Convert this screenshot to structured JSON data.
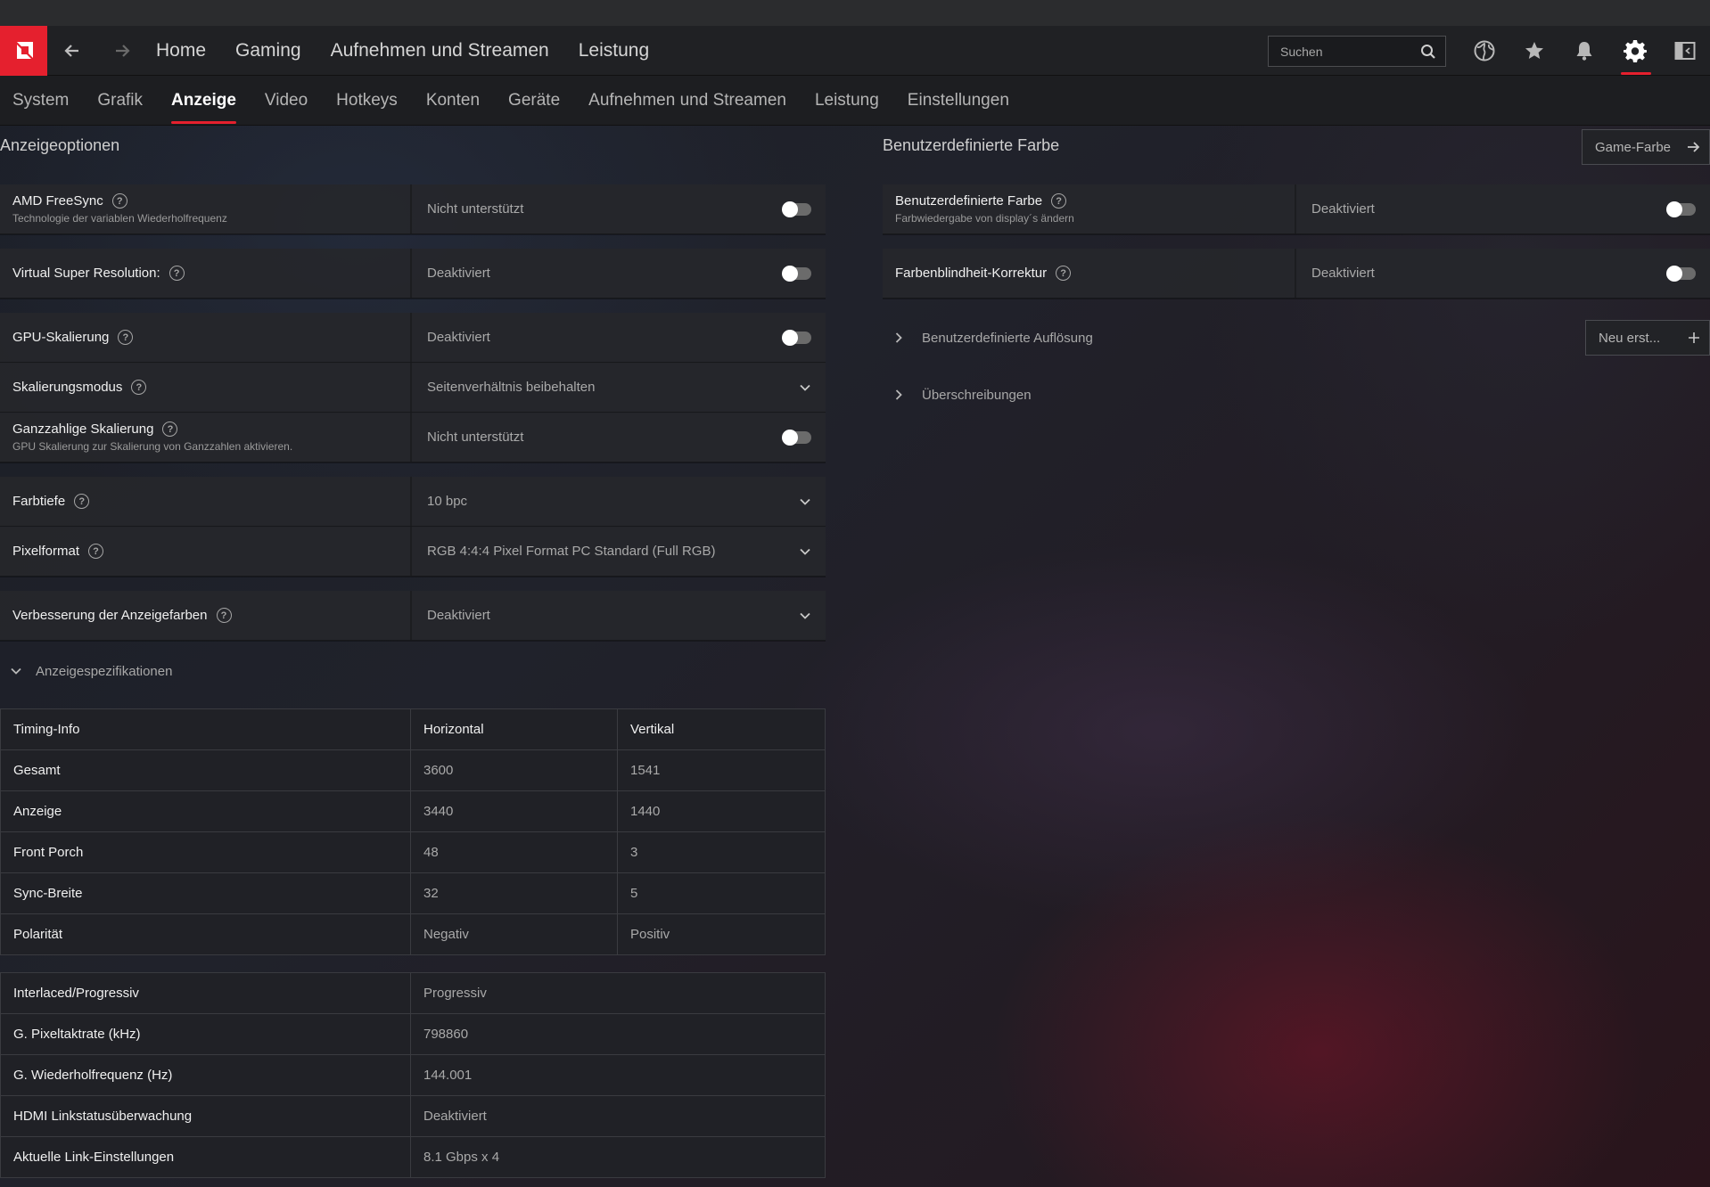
{
  "topnav": {
    "links": [
      "Home",
      "Gaming",
      "Aufnehmen und Streamen",
      "Leistung"
    ],
    "search_placeholder": "Suchen",
    "icons": [
      "amd-logo",
      "back-arrow",
      "forward-arrow",
      "search-icon",
      "globe-icon",
      "star-icon",
      "bell-icon",
      "gear-icon",
      "sidebar-toggle-icon"
    ],
    "accent_color": "#e5202e"
  },
  "subtabs": {
    "items": [
      "System",
      "Grafik",
      "Anzeige",
      "Video",
      "Hotkeys",
      "Konten",
      "Geräte",
      "Aufnehmen und Streamen",
      "Leistung",
      "Einstellungen"
    ],
    "active": "Anzeige"
  },
  "left": {
    "title": "Anzeigeoptionen",
    "rows": [
      {
        "label": "AMD FreeSync",
        "sub": "Technologie der variablen Wiederholfrequenz",
        "value": "Nicht unterstützt",
        "control": "toggle"
      },
      {
        "label": "Virtual Super Resolution:",
        "value": "Deaktiviert",
        "control": "toggle"
      },
      {
        "label": "GPU-Skalierung",
        "value": "Deaktiviert",
        "control": "toggle"
      },
      {
        "label": "Skalierungsmodus",
        "value": "Seitenverhältnis beibehalten",
        "control": "dropdown"
      },
      {
        "label": "Ganzzahlige Skalierung",
        "sub": "GPU Skalierung zur Skalierung von Ganzzahlen aktivieren.",
        "value": "Nicht unterstützt",
        "control": "toggle"
      },
      {
        "label": "Farbtiefe",
        "value": "10 bpc",
        "control": "dropdown"
      },
      {
        "label": "Pixelformat",
        "value": "RGB 4:4:4 Pixel Format PC Standard (Full RGB)",
        "control": "dropdown"
      },
      {
        "label": "Verbesserung der Anzeigefarben",
        "value": "Deaktiviert",
        "control": "dropdown"
      }
    ],
    "specs_label": "Anzeigespezifikationen",
    "timing": {
      "headers": [
        "Timing-Info",
        "Horizontal",
        "Vertikal"
      ],
      "rows": [
        [
          "Gesamt",
          "3600",
          "1541"
        ],
        [
          "Anzeige",
          "3440",
          "1440"
        ],
        [
          "Front Porch",
          "48",
          "3"
        ],
        [
          "Sync-Breite",
          "32",
          "5"
        ],
        [
          "Polarität",
          "Negativ",
          "Positiv"
        ]
      ]
    },
    "info": [
      [
        "Interlaced/Progressiv",
        "Progressiv"
      ],
      [
        "G. Pixeltaktrate (kHz)",
        "798860"
      ],
      [
        "G. Wiederholfrequenz (Hz)",
        "144.001"
      ],
      [
        "HDMI Linkstatusüberwachung",
        "Deaktiviert"
      ],
      [
        "Aktuelle Link-Einstellungen",
        "8.1 Gbps x 4"
      ]
    ]
  },
  "right": {
    "title": "Benutzerdefinierte Farbe",
    "game_color_button": "Game-Farbe",
    "rows": [
      {
        "label": "Benutzerdefinierte Farbe",
        "sub": "Farbwiedergabe von display´s ändern",
        "value": "Deaktiviert",
        "control": "toggle"
      },
      {
        "label": "Farbenblindheit-Korrektur",
        "value": "Deaktiviert",
        "control": "toggle"
      }
    ],
    "custom_resolution": "Benutzerdefinierte Auflösung",
    "new_button": "Neu erst...",
    "overrides": "Überschreibungen"
  }
}
